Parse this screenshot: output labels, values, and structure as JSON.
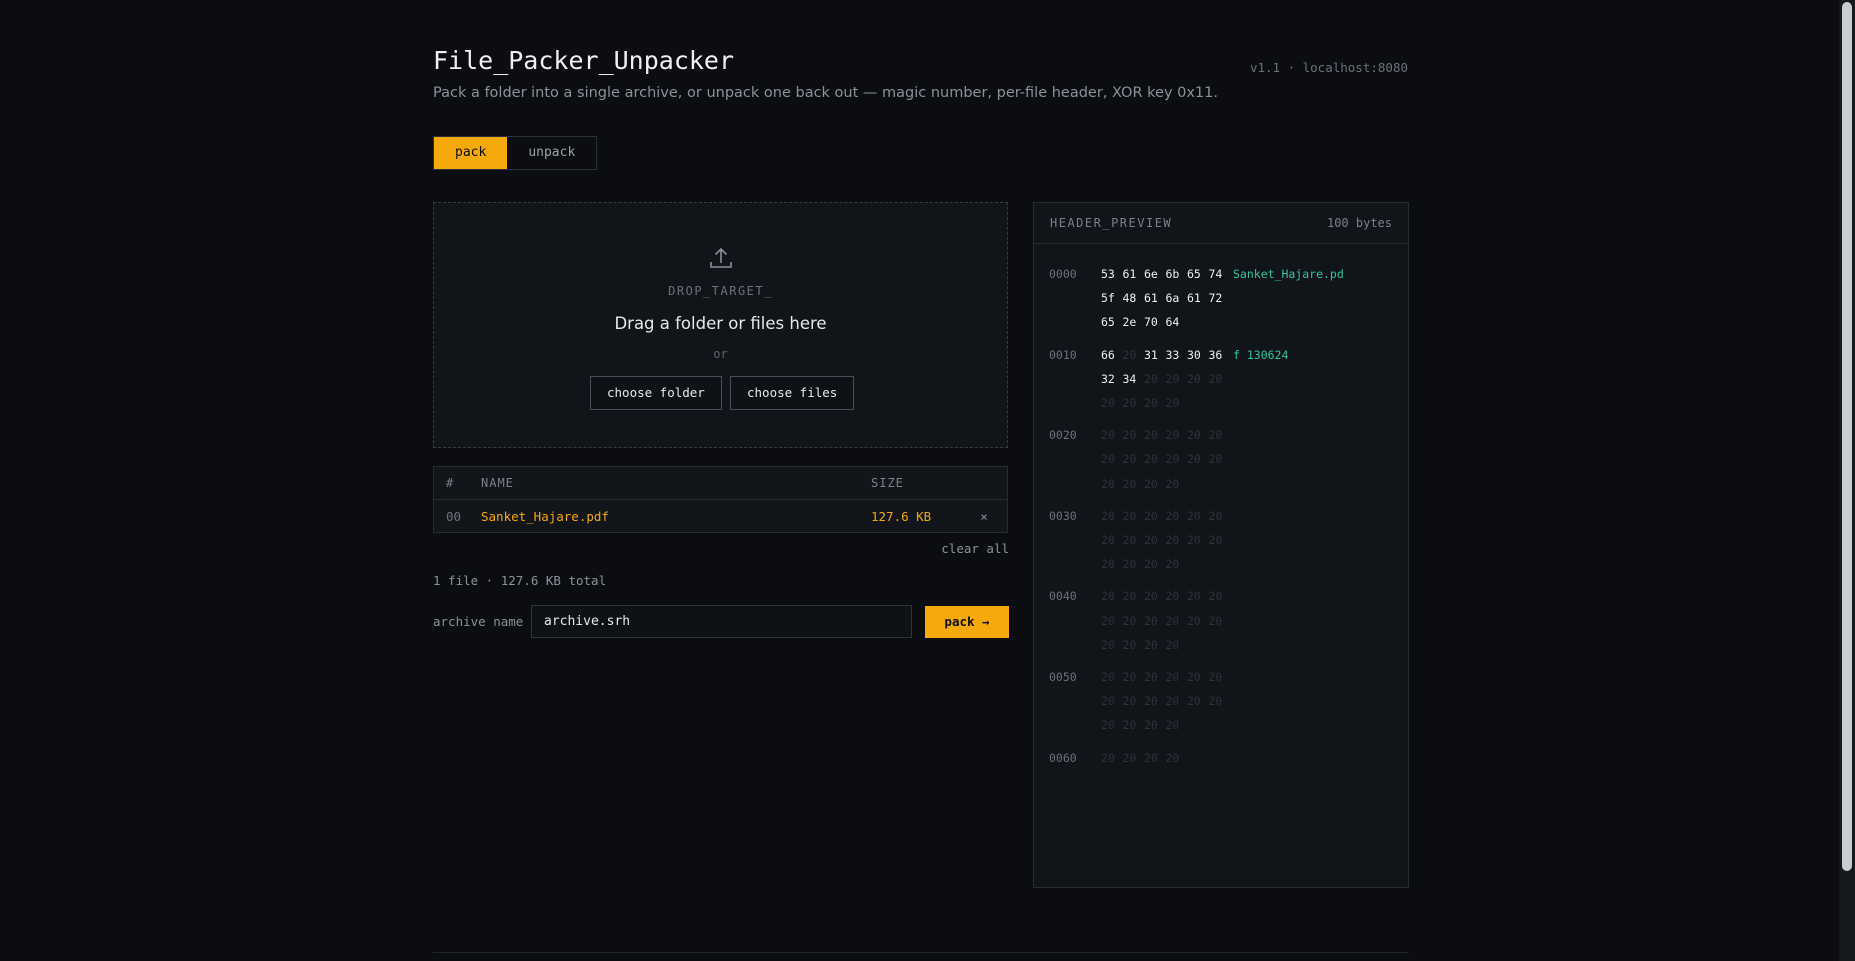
{
  "header": {
    "title": "File_Packer_Unpacker",
    "subtitle": "Pack a folder into a single archive, or unpack one back out — magic number, per-file header, XOR key 0x11.",
    "version": "v1.1 · localhost:8080"
  },
  "tabs": [
    {
      "label": "pack",
      "active": true
    },
    {
      "label": "unpack",
      "active": false
    }
  ],
  "drop_zone": {
    "icon": "upload-icon",
    "label": "DROP_TARGET_",
    "instruction": "Drag a folder or files here",
    "or": "or",
    "choose_folder": "choose folder",
    "choose_files": "choose files"
  },
  "file_table": {
    "columns": [
      "#",
      "NAME",
      "SIZE"
    ],
    "rows": [
      {
        "index": "00",
        "name": "Sanket_Hajare.pdf",
        "size": "127.6 KB",
        "remove": "×"
      }
    ]
  },
  "clear_all": "clear all",
  "summary": "1 file · 127.6 KB total",
  "archive": {
    "label": "archive name",
    "value": "archive.srh",
    "pack_label": "pack →"
  },
  "hex_preview": {
    "title": "HEADER_PREVIEW",
    "size": "100 bytes",
    "rows": [
      {
        "offset": "0000",
        "bytes": [
          "53",
          "61",
          "6e",
          "6b",
          "65",
          "74",
          "5f",
          "48",
          "61",
          "6a",
          "61",
          "72",
          "65",
          "2e",
          "70",
          "64"
        ],
        "ascii": "Sanket_Hajare.pd"
      },
      {
        "offset": "0010",
        "bytes": [
          "66",
          "20",
          "31",
          "33",
          "30",
          "36",
          "32",
          "34",
          "20",
          "20",
          "20",
          "20",
          "20",
          "20",
          "20",
          "20"
        ],
        "ascii": "f 130624"
      },
      {
        "offset": "0020",
        "bytes": [
          "20",
          "20",
          "20",
          "20",
          "20",
          "20",
          "20",
          "20",
          "20",
          "20",
          "20",
          "20",
          "20",
          "20",
          "20",
          "20"
        ],
        "ascii": ""
      },
      {
        "offset": "0030",
        "bytes": [
          "20",
          "20",
          "20",
          "20",
          "20",
          "20",
          "20",
          "20",
          "20",
          "20",
          "20",
          "20",
          "20",
          "20",
          "20",
          "20"
        ],
        "ascii": ""
      },
      {
        "offset": "0040",
        "bytes": [
          "20",
          "20",
          "20",
          "20",
          "20",
          "20",
          "20",
          "20",
          "20",
          "20",
          "20",
          "20",
          "20",
          "20",
          "20",
          "20"
        ],
        "ascii": ""
      },
      {
        "offset": "0050",
        "bytes": [
          "20",
          "20",
          "20",
          "20",
          "20",
          "20",
          "20",
          "20",
          "20",
          "20",
          "20",
          "20",
          "20",
          "20",
          "20",
          "20"
        ],
        "ascii": ""
      },
      {
        "offset": "0060",
        "bytes": [
          "20",
          "20",
          "20",
          "20"
        ],
        "ascii": ""
      }
    ]
  },
  "colors": {
    "accent": "#f5a90b",
    "background": "#0b0d10",
    "panel": "#111419",
    "ascii": "#2fc4a6"
  }
}
